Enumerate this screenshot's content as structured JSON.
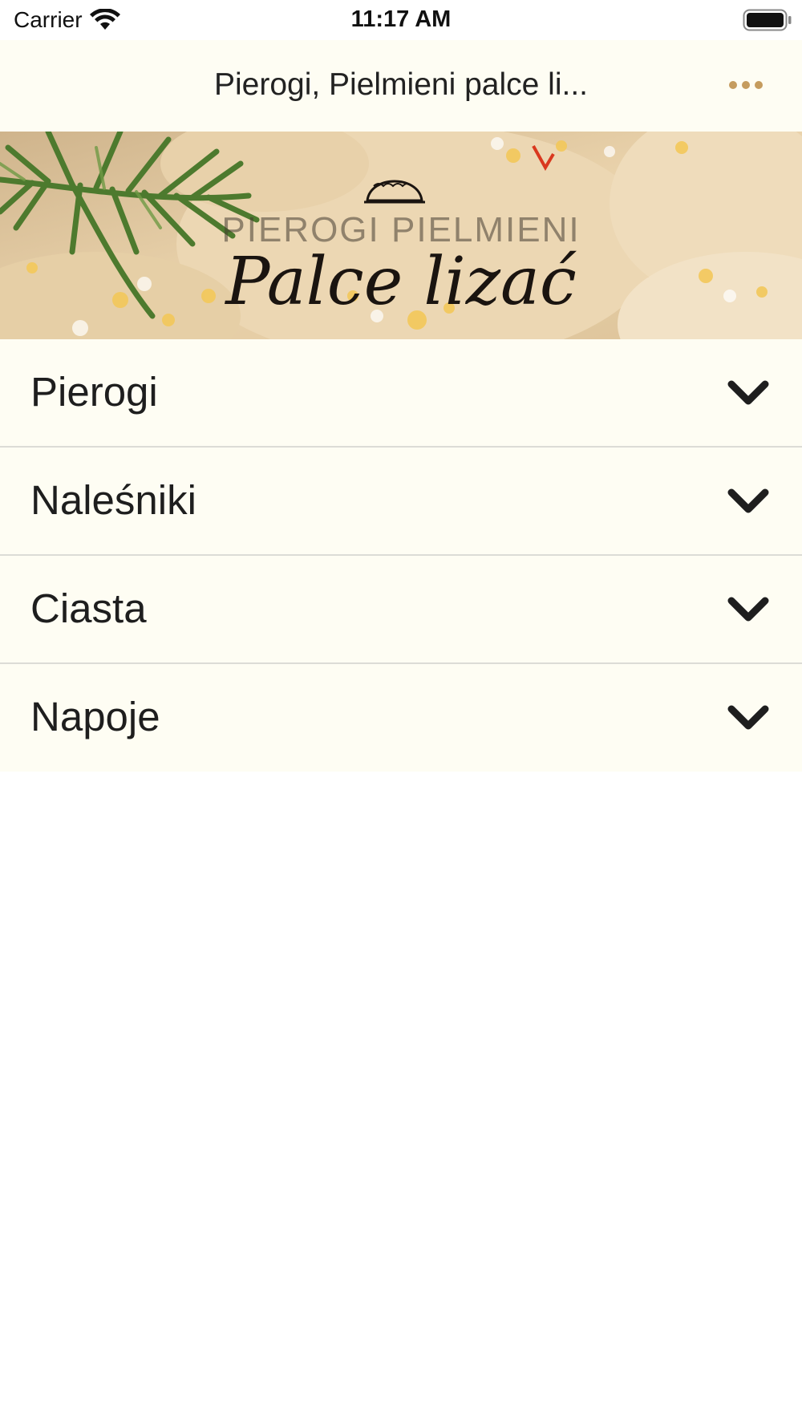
{
  "status_bar": {
    "carrier": "Carrier",
    "time": "11:17 AM",
    "wifi_icon": "wifi-icon",
    "battery_icon": "battery-full-icon"
  },
  "nav_bar": {
    "title": "Pierogi, Pielmieni palce li...",
    "more_icon": "ellipsis-icon",
    "accent_color": "#c59c5e",
    "background_color": "#fefdf3"
  },
  "banner": {
    "brand_text": "PIEROGI PIELMIENI",
    "script_text": "Palce lizać",
    "logo_icon": "dumpling-logo-icon"
  },
  "categories": [
    {
      "label": "Pierogi",
      "icon": "chevron-down-icon"
    },
    {
      "label": "Naleśniki",
      "icon": "chevron-down-icon"
    },
    {
      "label": "Ciasta",
      "icon": "chevron-down-icon"
    },
    {
      "label": "Napoje",
      "icon": "chevron-down-icon"
    }
  ]
}
